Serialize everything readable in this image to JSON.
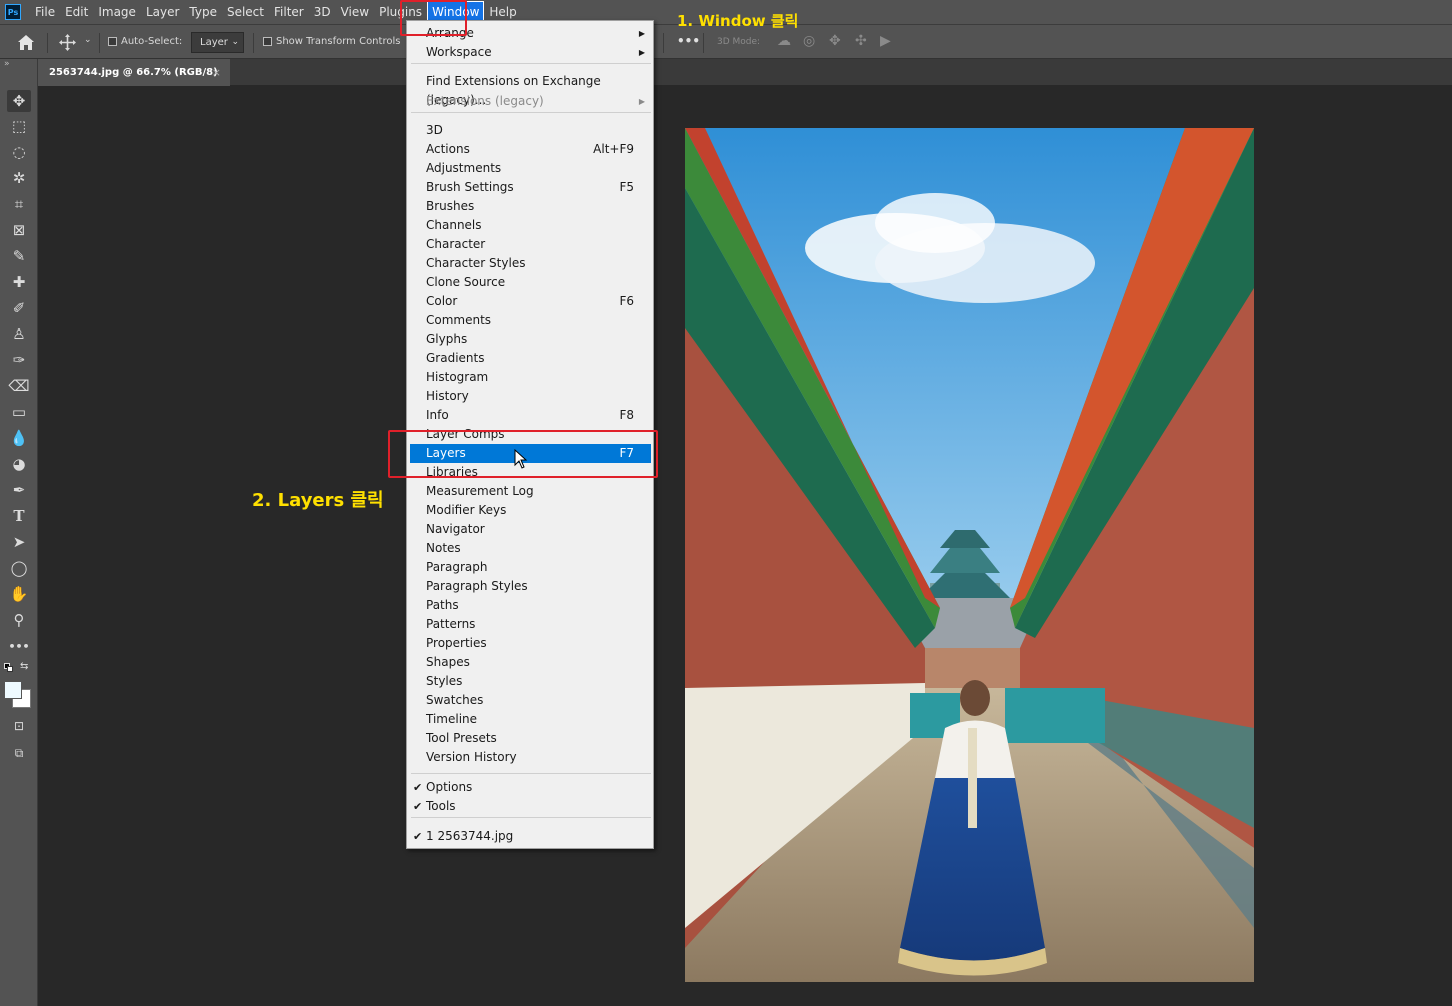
{
  "app": {
    "logo": "Ps"
  },
  "menubar": {
    "items": [
      "File",
      "Edit",
      "Image",
      "Layer",
      "Type",
      "Select",
      "Filter",
      "3D",
      "View",
      "Plugins",
      "Window",
      "Help"
    ]
  },
  "options": {
    "auto_select_label": "Auto-Select:",
    "auto_select_value": "Layer",
    "show_transform_label": "Show Transform Controls",
    "more": "•••",
    "mode_3d_label": "3D Mode:"
  },
  "document": {
    "tab_title": "2563744.jpg @ 66.7% (RGB/8)",
    "close": "×"
  },
  "window_menu": {
    "group1": [
      {
        "label": "Arrange",
        "submenu": true
      },
      {
        "label": "Workspace",
        "submenu": true
      }
    ],
    "group2": [
      {
        "label": "Find Extensions on Exchange (legacy)..."
      },
      {
        "label": "Extensions (legacy)",
        "submenu": true,
        "disabled": true
      }
    ],
    "group3": [
      {
        "label": "3D",
        "shortcut": ""
      },
      {
        "label": "Actions",
        "shortcut": "Alt+F9"
      },
      {
        "label": "Adjustments",
        "shortcut": ""
      },
      {
        "label": "Brush Settings",
        "shortcut": "F5"
      },
      {
        "label": "Brushes",
        "shortcut": ""
      },
      {
        "label": "Channels",
        "shortcut": ""
      },
      {
        "label": "Character",
        "shortcut": ""
      },
      {
        "label": "Character Styles",
        "shortcut": ""
      },
      {
        "label": "Clone Source",
        "shortcut": ""
      },
      {
        "label": "Color",
        "shortcut": "F6"
      },
      {
        "label": "Comments",
        "shortcut": ""
      },
      {
        "label": "Glyphs",
        "shortcut": ""
      },
      {
        "label": "Gradients",
        "shortcut": ""
      },
      {
        "label": "Histogram",
        "shortcut": ""
      },
      {
        "label": "History",
        "shortcut": ""
      },
      {
        "label": "Info",
        "shortcut": "F8"
      },
      {
        "label": "Layer Comps",
        "shortcut": ""
      },
      {
        "label": "Layers",
        "shortcut": "F7",
        "highlighted": true
      },
      {
        "label": "Libraries",
        "shortcut": ""
      },
      {
        "label": "Measurement Log",
        "shortcut": ""
      },
      {
        "label": "Modifier Keys",
        "shortcut": ""
      },
      {
        "label": "Navigator",
        "shortcut": ""
      },
      {
        "label": "Notes",
        "shortcut": ""
      },
      {
        "label": "Paragraph",
        "shortcut": ""
      },
      {
        "label": "Paragraph Styles",
        "shortcut": ""
      },
      {
        "label": "Paths",
        "shortcut": ""
      },
      {
        "label": "Patterns",
        "shortcut": ""
      },
      {
        "label": "Properties",
        "shortcut": ""
      },
      {
        "label": "Shapes",
        "shortcut": ""
      },
      {
        "label": "Styles",
        "shortcut": ""
      },
      {
        "label": "Swatches",
        "shortcut": ""
      },
      {
        "label": "Timeline",
        "shortcut": ""
      },
      {
        "label": "Tool Presets",
        "shortcut": ""
      },
      {
        "label": "Version History",
        "shortcut": ""
      }
    ],
    "group4": [
      {
        "label": "Options",
        "checked": true
      },
      {
        "label": "Tools",
        "checked": true
      }
    ],
    "group5": [
      {
        "label": "1 2563744.jpg",
        "checked": true
      }
    ],
    "check_glyph": "✔",
    "arrow_glyph": "▶"
  },
  "annotations": {
    "step1": "1. Window 클릭",
    "step2": "2. Layers 클릭"
  },
  "colors": {
    "accent": "#0078d7",
    "annotation_red": "#e0202a",
    "annotation_yellow": "#ffe000",
    "ui_panel": "#535353",
    "canvas_bg": "#282828"
  },
  "tools": [
    "move-icon",
    "marquee-icon",
    "lasso-icon",
    "magic-wand-icon",
    "crop-icon",
    "frame-icon",
    "eyedropper-icon",
    "healing-brush-icon",
    "brush-icon",
    "stamp-icon",
    "history-brush-icon",
    "eraser-icon",
    "gradient-icon",
    "blur-icon",
    "dodge-icon",
    "pen-icon",
    "type-icon",
    "path-select-icon",
    "ellipse-icon",
    "hand-icon",
    "zoom-icon",
    "more-tools-icon"
  ],
  "tool_glyphs": [
    "✥",
    "⬚",
    "◌",
    "✲",
    "⌗",
    "⊠",
    "✎",
    "✚",
    "✐",
    "♙",
    "✑",
    "⌫",
    "▭",
    "💧",
    "◕",
    "✒",
    "T",
    "➤",
    "◯",
    "✋",
    "⚲",
    "•••"
  ]
}
